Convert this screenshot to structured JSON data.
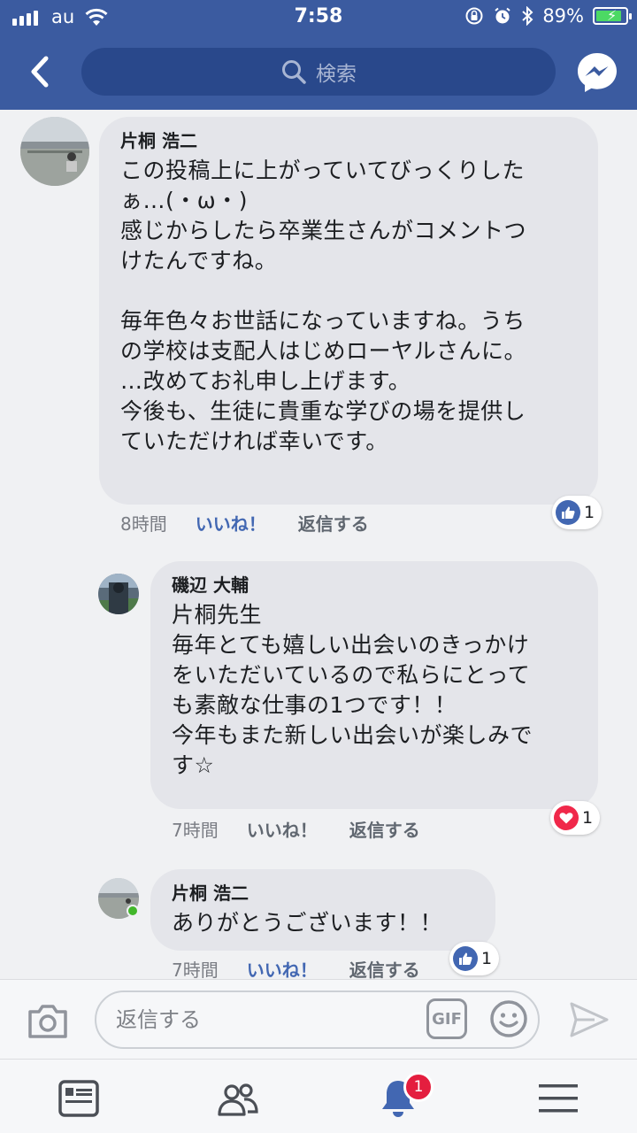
{
  "status_bar": {
    "carrier": "au",
    "time": "7:58",
    "battery_pct": "89%",
    "battery_level": 0.89
  },
  "header": {
    "search_placeholder": "検索"
  },
  "comments": [
    {
      "author": "片桐 浩二",
      "text": "この投稿上に上がっていてびっくりした\nぁ…(・ω・)\n感じからしたら卒業生さんがコメントつ\nけたんですね。\n\n毎年色々お世話になっていますね。うち\nの学校は支配人はじめローヤルさんに。\n…改めてお礼申し上げます。\n今後も、生徒に貴重な学びの場を提供し\nていただければ幸いです。",
      "time": "8時間",
      "like_label": "いいね！",
      "reply_label": "返信する",
      "reaction": "like",
      "reaction_count": "1"
    },
    {
      "author": "磯辺 大輔",
      "text": "片桐先生\n毎年とても嬉しい出会いのきっかけ\nをいただいているので私らにとって\nも素敵な仕事の1つです！！\n今年もまた新しい出会いが楽しみで\nす☆",
      "time": "7時間",
      "like_label": "いいね！",
      "reply_label": "返信する",
      "reaction": "love",
      "reaction_count": "1"
    },
    {
      "author": "片桐 浩二",
      "text": "ありがとうございます！！",
      "time": "7時間",
      "like_label": "いいね！",
      "reply_label": "返信する",
      "reaction": "like",
      "reaction_count": "1",
      "online": true
    }
  ],
  "reply_bar": {
    "placeholder": "返信する",
    "gif_label": "GIF"
  },
  "tab_bar": {
    "notification_badge": "1"
  },
  "colors": {
    "header_bg": "#3b5ba0",
    "like_blue": "#4267b2",
    "love_red": "#f0284a",
    "badge_red": "#e41e3f",
    "bubble_bg": "#e4e5ea"
  }
}
